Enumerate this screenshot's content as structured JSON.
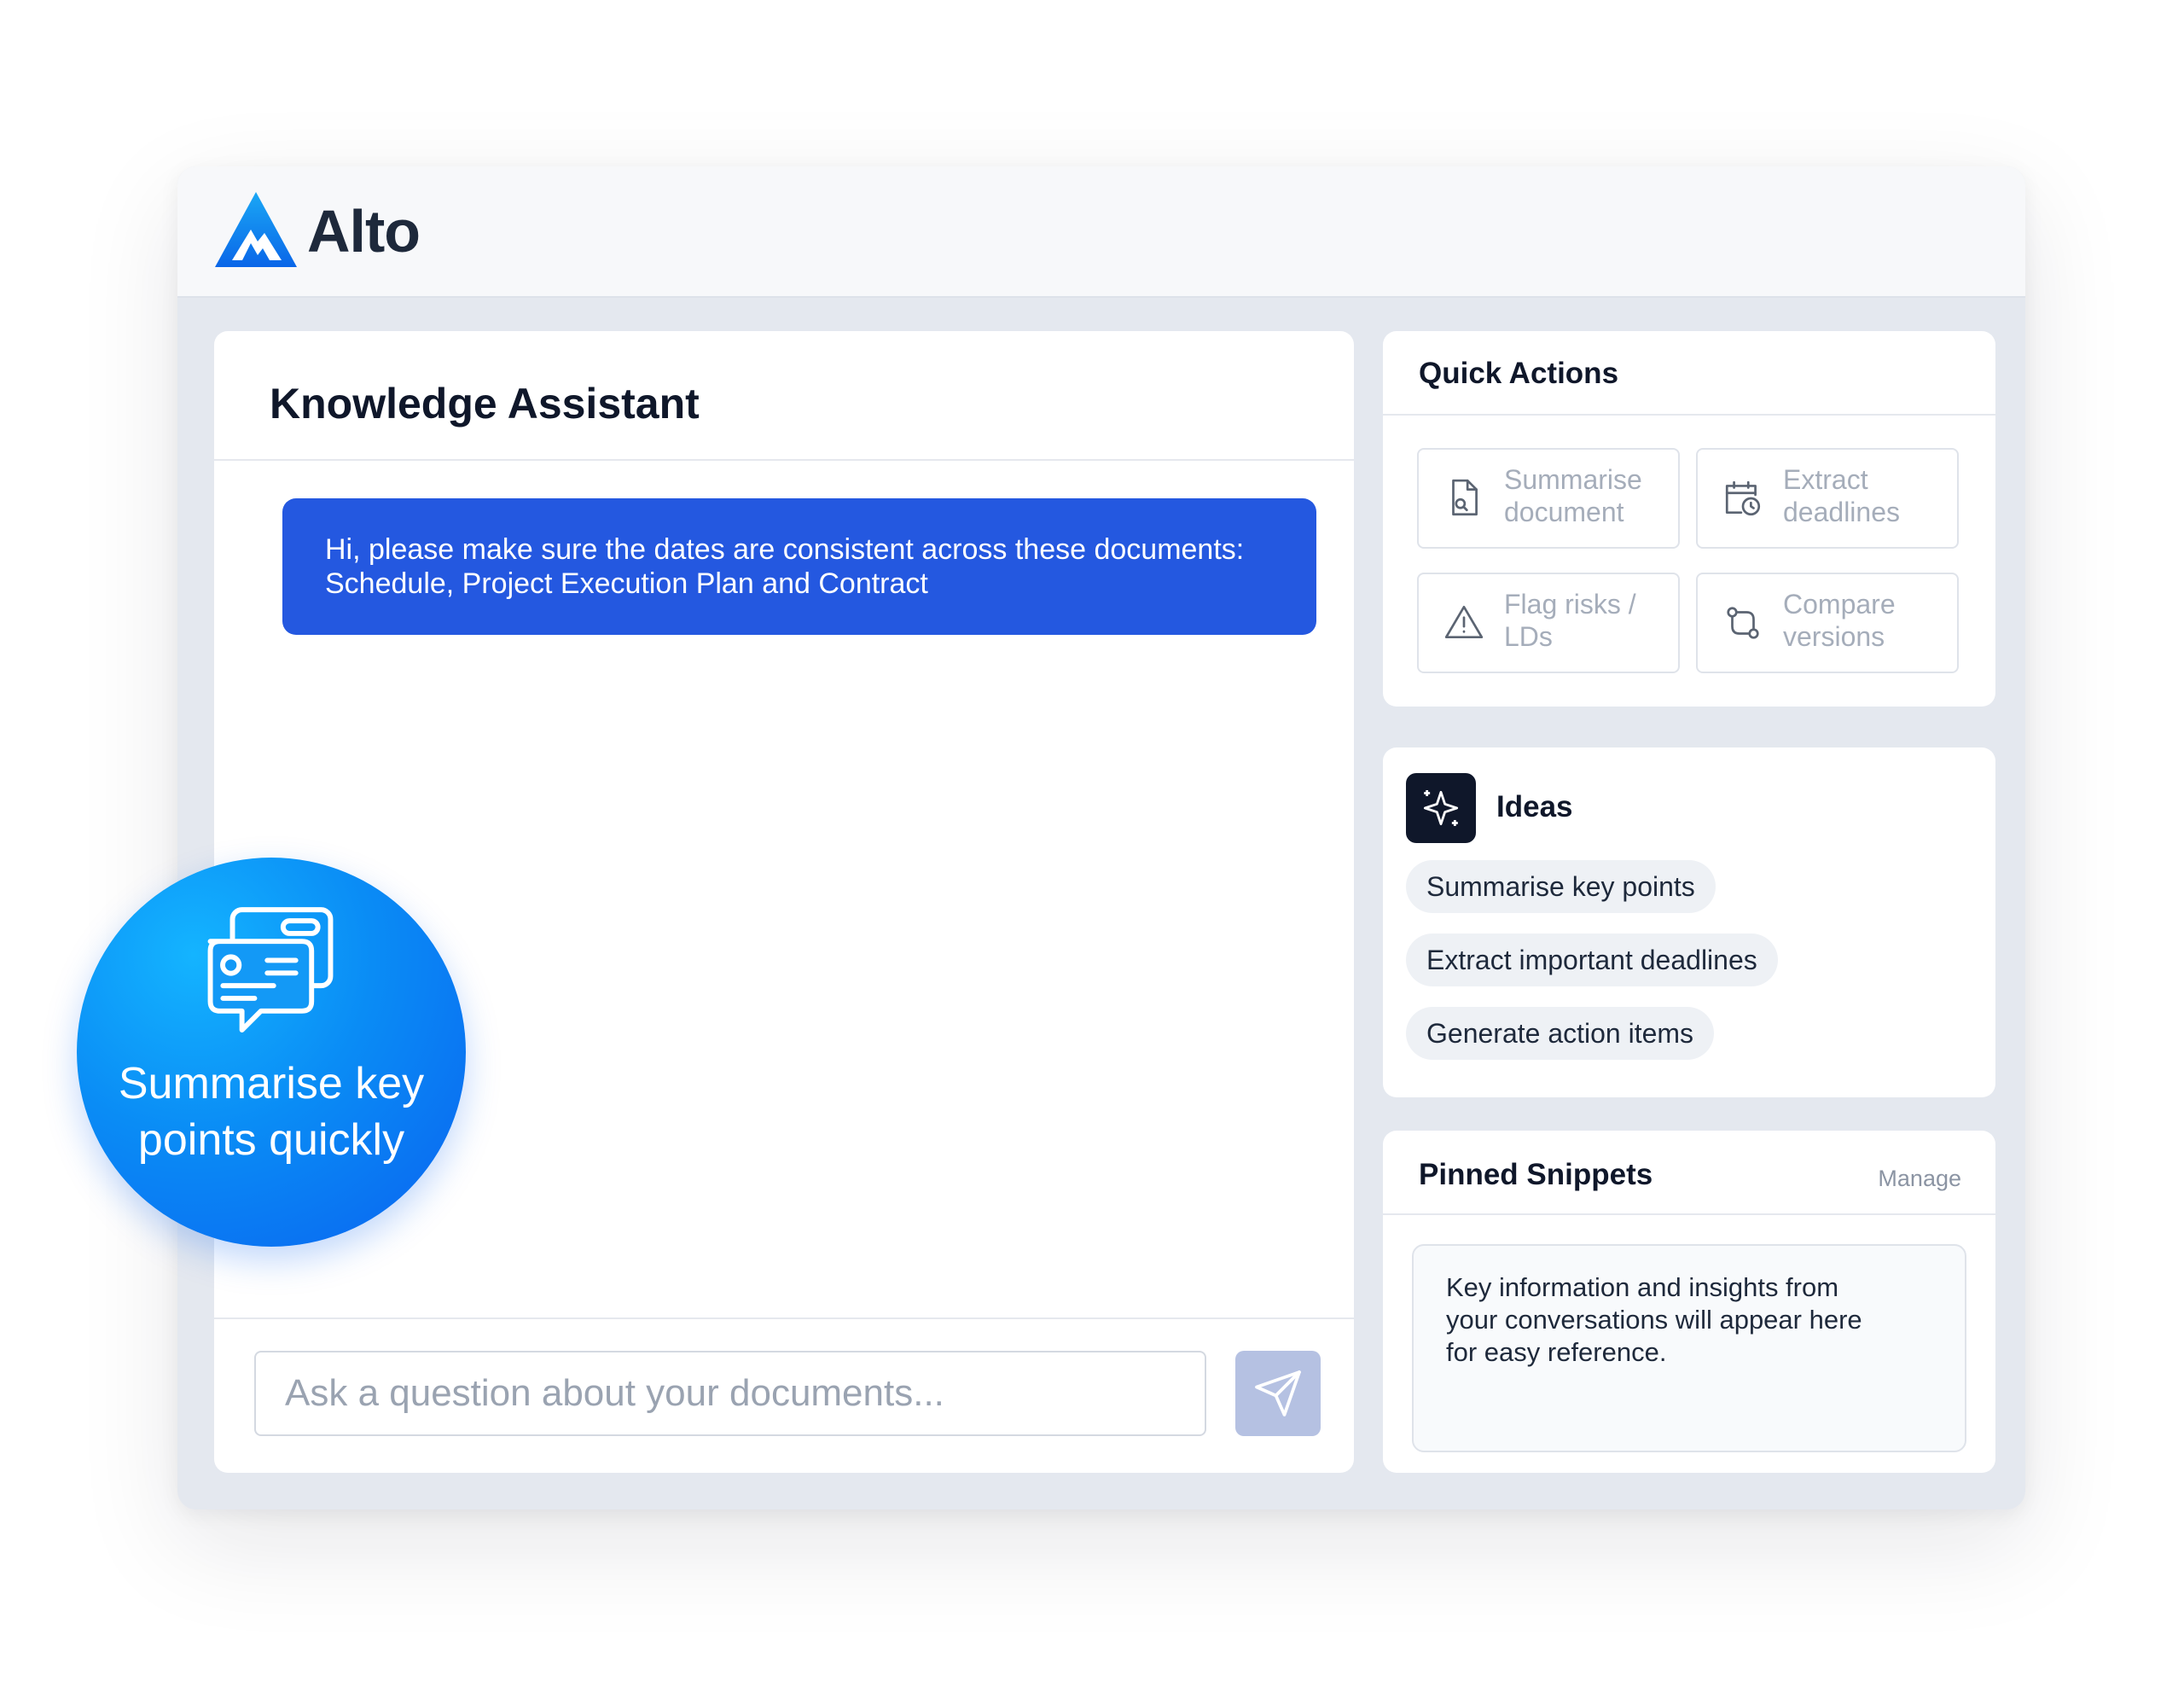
{
  "app": {
    "name": "Alto"
  },
  "chat": {
    "title": "Knowledge Assistant",
    "messages": [
      {
        "role": "user",
        "lines": [
          "Hi, please make sure the dates are consistent across these documents:",
          "Schedule, Project Execution Plan and Contract"
        ]
      }
    ],
    "input_placeholder": "Ask a question about your documents...",
    "send_icon": "send-icon"
  },
  "quick_actions": {
    "title": "Quick Actions",
    "items": [
      {
        "icon": "document-search-icon",
        "lines": [
          "Summarise",
          "document"
        ]
      },
      {
        "icon": "calendar-clock-icon",
        "lines": [
          "Extract",
          "deadlines"
        ]
      },
      {
        "icon": "warning-icon",
        "lines": [
          "Flag risks /",
          "LDs"
        ]
      },
      {
        "icon": "compare-icon",
        "lines": [
          "Compare",
          "versions"
        ]
      }
    ]
  },
  "ideas": {
    "title": "Ideas",
    "icon": "sparkle-icon",
    "items": [
      "Summarise key points",
      "Extract important deadlines",
      "Generate action items"
    ]
  },
  "pinned": {
    "title": "Pinned Snippets",
    "manage_label": "Manage",
    "empty_lines": [
      "Key information and insights from",
      "your conversations will appear here",
      "for easy reference."
    ]
  },
  "badge": {
    "icon": "chat-cards-icon",
    "lines": [
      "Summarise key",
      "points quickly"
    ]
  },
  "colors": {
    "accent": "#2458e0",
    "brand": "#0a8cf5",
    "send_button": "#b5c1e2"
  }
}
